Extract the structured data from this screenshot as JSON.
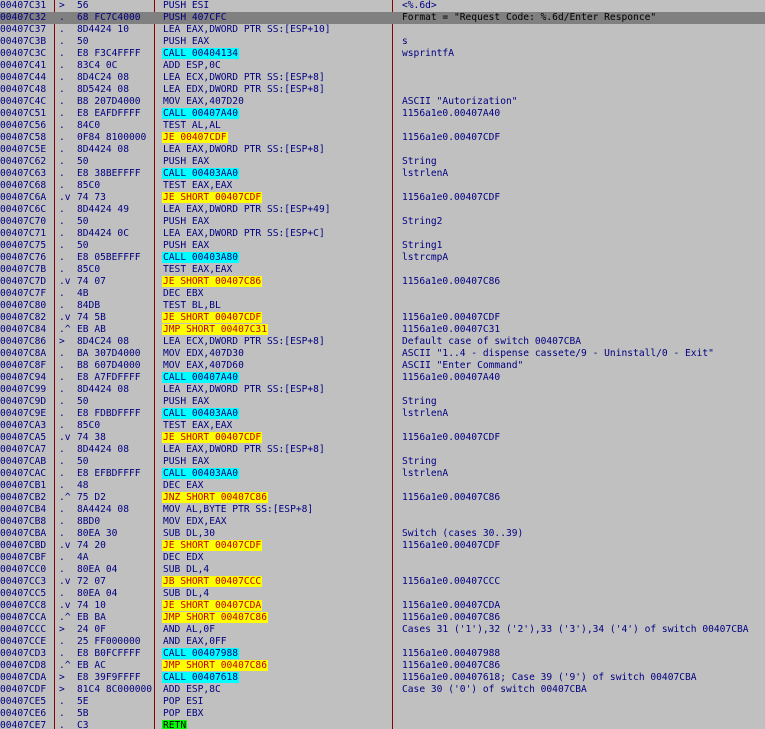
{
  "rows": [
    {
      "addr": "00407C31",
      "mark": ">",
      "hex": "56",
      "disasm": "PUSH ESI",
      "hl": "",
      "cmt": "<%.6d>"
    },
    {
      "addr": "00407C32",
      "mark": ".",
      "hex": "68 FC7C4000",
      "disasm": "PUSH 407CFC",
      "hl": "",
      "cmt": "Format = \"Request Code: %.6d/Enter Responce\"",
      "sel": true
    },
    {
      "addr": "00407C37",
      "mark": ".",
      "hex": "8D4424 10",
      "disasm": "LEA EAX,DWORD PTR SS:[ESP+10]",
      "hl": "",
      "cmt": ""
    },
    {
      "addr": "00407C3B",
      "mark": ".",
      "hex": "50",
      "disasm": "PUSH EAX",
      "hl": "",
      "cmt": "s"
    },
    {
      "addr": "00407C3C",
      "mark": ".",
      "hex": "E8 F3C4FFFF",
      "disasm": "CALL 00404134",
      "hl": "cyan",
      "cmt": "wsprintfA"
    },
    {
      "addr": "00407C41",
      "mark": ".",
      "hex": "83C4 0C",
      "disasm": "ADD ESP,0C",
      "hl": "",
      "cmt": ""
    },
    {
      "addr": "00407C44",
      "mark": ".",
      "hex": "8D4C24 08",
      "disasm": "LEA ECX,DWORD PTR SS:[ESP+8]",
      "hl": "",
      "cmt": ""
    },
    {
      "addr": "00407C48",
      "mark": ".",
      "hex": "8D5424 08",
      "disasm": "LEA EDX,DWORD PTR SS:[ESP+8]",
      "hl": "",
      "cmt": ""
    },
    {
      "addr": "00407C4C",
      "mark": ".",
      "hex": "B8 207D4000",
      "disasm": "MOV EAX,407D20",
      "hl": "",
      "cmt": "ASCII \"Autorization\""
    },
    {
      "addr": "00407C51",
      "mark": ".",
      "hex": "E8 EAFDFFFF",
      "disasm": "CALL 00407A40",
      "hl": "cyan",
      "cmt": "1156a1e0.00407A40"
    },
    {
      "addr": "00407C56",
      "mark": ".",
      "hex": "84C0",
      "disasm": "TEST AL,AL",
      "hl": "",
      "cmt": ""
    },
    {
      "addr": "00407C58",
      "mark": ".",
      "hex": "0F84 8100000",
      "disasm": "JE 00407CDF",
      "hl": "yellow",
      "cmt": "1156a1e0.00407CDF"
    },
    {
      "addr": "00407C5E",
      "mark": ".",
      "hex": "8D4424 08",
      "disasm": "LEA EAX,DWORD PTR SS:[ESP+8]",
      "hl": "",
      "cmt": ""
    },
    {
      "addr": "00407C62",
      "mark": ".",
      "hex": "50",
      "disasm": "PUSH EAX",
      "hl": "",
      "cmt": "String"
    },
    {
      "addr": "00407C63",
      "mark": ".",
      "hex": "E8 38BEFFFF",
      "disasm": "CALL 00403AA0",
      "hl": "cyan",
      "cmt": "lstrlenA"
    },
    {
      "addr": "00407C68",
      "mark": ".",
      "hex": "85C0",
      "disasm": "TEST EAX,EAX",
      "hl": "",
      "cmt": ""
    },
    {
      "addr": "00407C6A",
      "mark": ".v",
      "hex": "74 73",
      "disasm": "JE SHORT 00407CDF",
      "hl": "yellow",
      "cmt": "1156a1e0.00407CDF"
    },
    {
      "addr": "00407C6C",
      "mark": ".",
      "hex": "8D4424 49",
      "disasm": "LEA EAX,DWORD PTR SS:[ESP+49]",
      "hl": "",
      "cmt": ""
    },
    {
      "addr": "00407C70",
      "mark": ".",
      "hex": "50",
      "disasm": "PUSH EAX",
      "hl": "",
      "cmt": "String2"
    },
    {
      "addr": "00407C71",
      "mark": ".",
      "hex": "8D4424 0C",
      "disasm": "LEA EAX,DWORD PTR SS:[ESP+C]",
      "hl": "",
      "cmt": ""
    },
    {
      "addr": "00407C75",
      "mark": ".",
      "hex": "50",
      "disasm": "PUSH EAX",
      "hl": "",
      "cmt": "String1"
    },
    {
      "addr": "00407C76",
      "mark": ".",
      "hex": "E8 05BEFFFF",
      "disasm": "CALL 00403A80",
      "hl": "cyan",
      "cmt": "lstrcmpA"
    },
    {
      "addr": "00407C7B",
      "mark": ".",
      "hex": "85C0",
      "disasm": "TEST EAX,EAX",
      "hl": "",
      "cmt": ""
    },
    {
      "addr": "00407C7D",
      "mark": ".v",
      "hex": "74 07",
      "disasm": "JE SHORT 00407C86",
      "hl": "yellow",
      "cmt": "1156a1e0.00407C86"
    },
    {
      "addr": "00407C7F",
      "mark": ".",
      "hex": "4B",
      "disasm": "DEC EBX",
      "hl": "",
      "cmt": ""
    },
    {
      "addr": "00407C80",
      "mark": ".",
      "hex": "84DB",
      "disasm": "TEST BL,BL",
      "hl": "",
      "cmt": ""
    },
    {
      "addr": "00407C82",
      "mark": ".v",
      "hex": "74 5B",
      "disasm": "JE SHORT 00407CDF",
      "hl": "yellow",
      "cmt": "1156a1e0.00407CDF"
    },
    {
      "addr": "00407C84",
      "mark": ".^",
      "hex": "EB AB",
      "disasm": "JMP SHORT 00407C31",
      "hl": "yellow",
      "cmt": "1156a1e0.00407C31"
    },
    {
      "addr": "00407C86",
      "mark": ">",
      "hex": "8D4C24 08",
      "disasm": "LEA ECX,DWORD PTR SS:[ESP+8]",
      "hl": "",
      "cmt": "Default case of switch 00407CBA"
    },
    {
      "addr": "00407C8A",
      "mark": ".",
      "hex": "BA 307D4000",
      "disasm": "MOV EDX,407D30",
      "hl": "",
      "cmt": "ASCII \"1..4 - dispense cassete/9 - Uninstall/0 - Exit\""
    },
    {
      "addr": "00407C8F",
      "mark": ".",
      "hex": "B8 607D4000",
      "disasm": "MOV EAX,407D60",
      "hl": "",
      "cmt": "ASCII \"Enter Command\""
    },
    {
      "addr": "00407C94",
      "mark": ".",
      "hex": "E8 A7FDFFFF",
      "disasm": "CALL 00407A40",
      "hl": "cyan",
      "cmt": "1156a1e0.00407A40"
    },
    {
      "addr": "00407C99",
      "mark": ".",
      "hex": "8D4424 08",
      "disasm": "LEA EAX,DWORD PTR SS:[ESP+8]",
      "hl": "",
      "cmt": ""
    },
    {
      "addr": "00407C9D",
      "mark": ".",
      "hex": "50",
      "disasm": "PUSH EAX",
      "hl": "",
      "cmt": "String"
    },
    {
      "addr": "00407C9E",
      "mark": ".",
      "hex": "E8 FDBDFFFF",
      "disasm": "CALL 00403AA0",
      "hl": "cyan",
      "cmt": "lstrlenA"
    },
    {
      "addr": "00407CA3",
      "mark": ".",
      "hex": "85C0",
      "disasm": "TEST EAX,EAX",
      "hl": "",
      "cmt": ""
    },
    {
      "addr": "00407CA5",
      "mark": ".v",
      "hex": "74 38",
      "disasm": "JE SHORT 00407CDF",
      "hl": "yellow",
      "cmt": "1156a1e0.00407CDF"
    },
    {
      "addr": "00407CA7",
      "mark": ".",
      "hex": "8D4424 08",
      "disasm": "LEA EAX,DWORD PTR SS:[ESP+8]",
      "hl": "",
      "cmt": ""
    },
    {
      "addr": "00407CAB",
      "mark": ".",
      "hex": "50",
      "disasm": "PUSH EAX",
      "hl": "",
      "cmt": "String"
    },
    {
      "addr": "00407CAC",
      "mark": ".",
      "hex": "E8 EFBDFFFF",
      "disasm": "CALL 00403AA0",
      "hl": "cyan",
      "cmt": "lstrlenA"
    },
    {
      "addr": "00407CB1",
      "mark": ".",
      "hex": "48",
      "disasm": "DEC EAX",
      "hl": "",
      "cmt": ""
    },
    {
      "addr": "00407CB2",
      "mark": ".^",
      "hex": "75 D2",
      "disasm": "JNZ SHORT 00407C86",
      "hl": "yellow",
      "cmt": "1156a1e0.00407C86"
    },
    {
      "addr": "00407CB4",
      "mark": ".",
      "hex": "8A4424 08",
      "disasm": "MOV AL,BYTE PTR SS:[ESP+8]",
      "hl": "",
      "cmt": ""
    },
    {
      "addr": "00407CB8",
      "mark": ".",
      "hex": "8BD0",
      "disasm": "MOV EDX,EAX",
      "hl": "",
      "cmt": ""
    },
    {
      "addr": "00407CBA",
      "mark": ".",
      "hex": "80EA 30",
      "disasm": "SUB DL,30",
      "hl": "",
      "cmt": "Switch (cases 30..39)"
    },
    {
      "addr": "00407CBD",
      "mark": ".v",
      "hex": "74 20",
      "disasm": "JE SHORT 00407CDF",
      "hl": "yellow",
      "cmt": "1156a1e0.00407CDF"
    },
    {
      "addr": "00407CBF",
      "mark": ".",
      "hex": "4A",
      "disasm": "DEC EDX",
      "hl": "",
      "cmt": ""
    },
    {
      "addr": "00407CC0",
      "mark": ".",
      "hex": "80EA 04",
      "disasm": "SUB DL,4",
      "hl": "",
      "cmt": ""
    },
    {
      "addr": "00407CC3",
      "mark": ".v",
      "hex": "72 07",
      "disasm": "JB SHORT 00407CCC",
      "hl": "yellow",
      "cmt": "1156a1e0.00407CCC"
    },
    {
      "addr": "00407CC5",
      "mark": ".",
      "hex": "80EA 04",
      "disasm": "SUB DL,4",
      "hl": "",
      "cmt": ""
    },
    {
      "addr": "00407CC8",
      "mark": ".v",
      "hex": "74 10",
      "disasm": "JE SHORT 00407CDA",
      "hl": "yellow",
      "cmt": "1156a1e0.00407CDA"
    },
    {
      "addr": "00407CCA",
      "mark": ".^",
      "hex": "EB BA",
      "disasm": "JMP SHORT 00407C86",
      "hl": "yellow",
      "cmt": "1156a1e0.00407C86"
    },
    {
      "addr": "00407CCC",
      "mark": ">",
      "hex": "24 0F",
      "disasm": "AND AL,0F",
      "hl": "",
      "cmt": "Cases 31 ('1'),32 ('2'),33 ('3'),34 ('4') of switch 00407CBA"
    },
    {
      "addr": "00407CCE",
      "mark": ".",
      "hex": "25 FF000000",
      "disasm": "AND EAX,0FF",
      "hl": "",
      "cmt": ""
    },
    {
      "addr": "00407CD3",
      "mark": ".",
      "hex": "E8 B0FCFFFF",
      "disasm": "CALL 00407988",
      "hl": "cyan",
      "cmt": "1156a1e0.00407988"
    },
    {
      "addr": "00407CD8",
      "mark": ".^",
      "hex": "EB AC",
      "disasm": "JMP SHORT 00407C86",
      "hl": "yellow",
      "cmt": "1156a1e0.00407C86"
    },
    {
      "addr": "00407CDA",
      "mark": ">",
      "hex": "E8 39F9FFFF",
      "disasm": "CALL 00407618",
      "hl": "cyan",
      "cmt": "1156a1e0.00407618; Case 39 ('9') of switch 00407CBA"
    },
    {
      "addr": "00407CDF",
      "mark": ">",
      "hex": "81C4 8C000000",
      "disasm": "ADD ESP,8C",
      "hl": "",
      "cmt": "Case 30 ('0') of switch 00407CBA"
    },
    {
      "addr": "00407CE5",
      "mark": ".",
      "hex": "5E",
      "disasm": "POP ESI",
      "hl": "",
      "cmt": ""
    },
    {
      "addr": "00407CE6",
      "mark": ".",
      "hex": "5B",
      "disasm": "POP EBX",
      "hl": "",
      "cmt": ""
    },
    {
      "addr": "00407CE7",
      "mark": ".",
      "hex": "C3",
      "disasm": "RETN",
      "hl": "green",
      "cmt": ""
    }
  ],
  "colors": {
    "background": "#c0c0c0",
    "selected": "#808080",
    "jump_highlight": "#ffff00",
    "call_highlight": "#00ffff",
    "ret_highlight": "#00ff00",
    "text": "#000080",
    "jump_text": "#c00000",
    "column_divider": "#8b0000"
  }
}
